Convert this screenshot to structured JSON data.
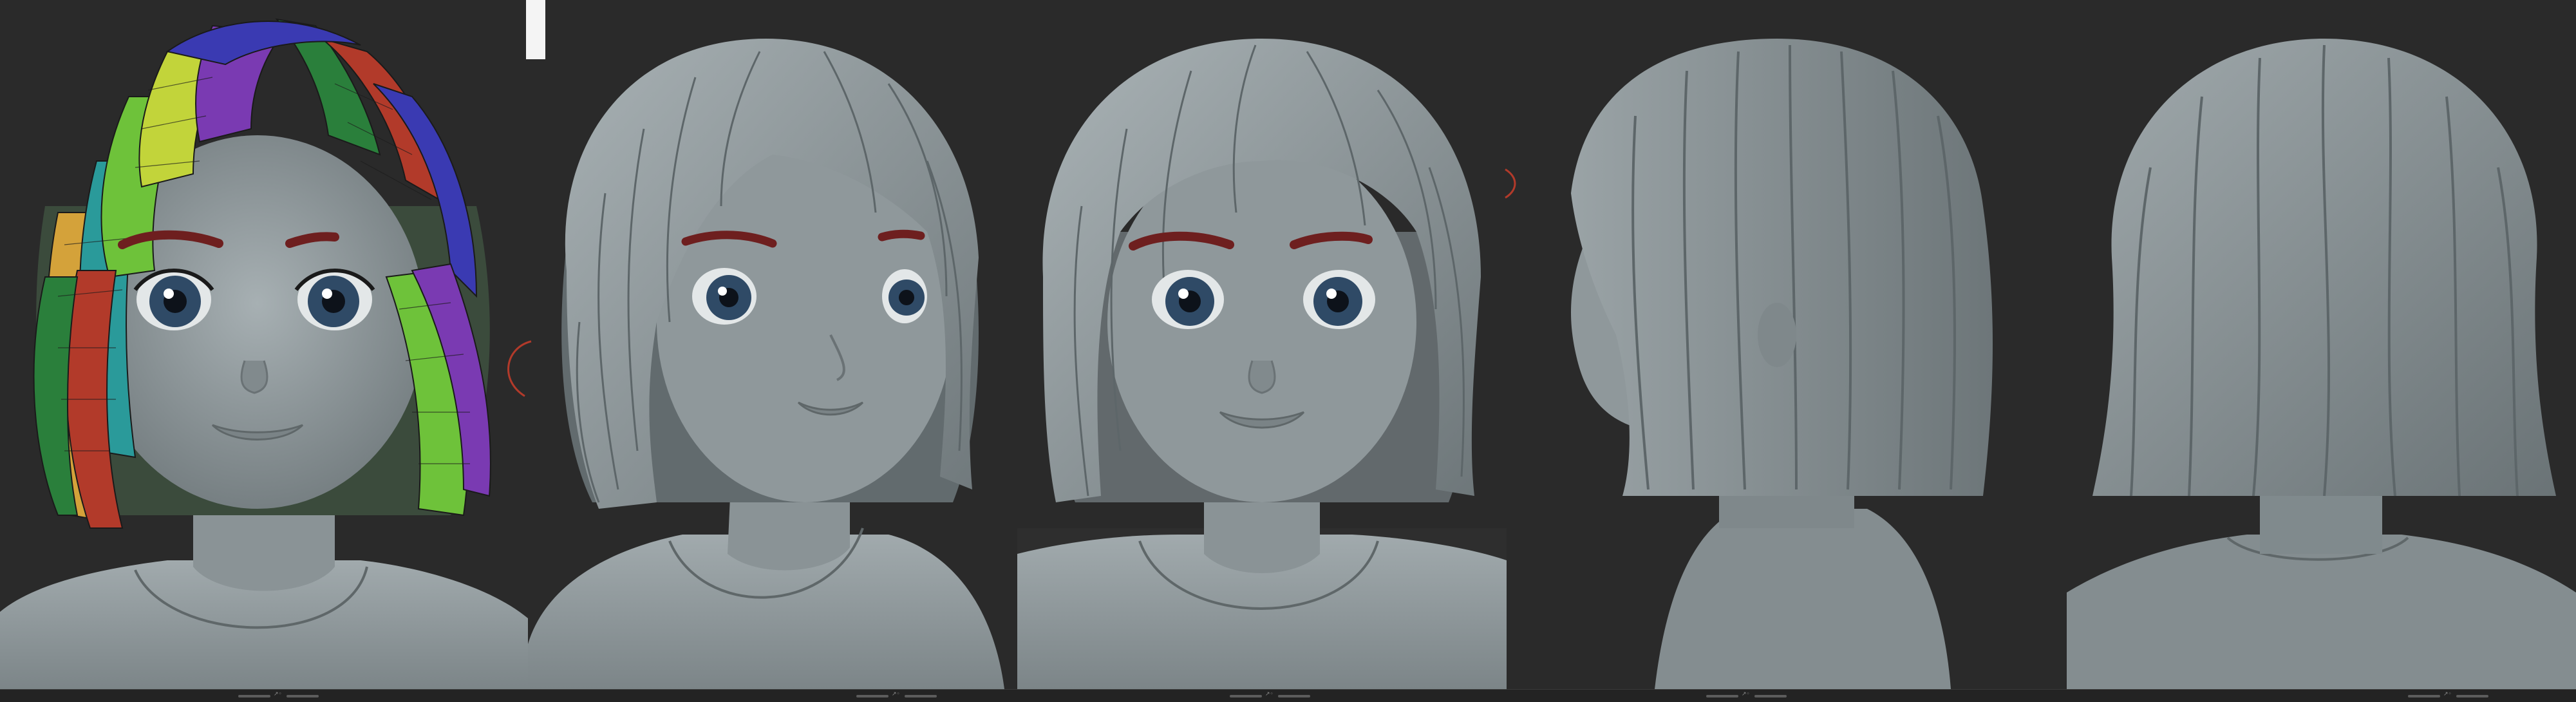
{
  "scene": {
    "background_color": "#2a2a2a",
    "skin_color": "#8e979a",
    "hair_color": "#8b9497",
    "brow_color": "#6e1f1f",
    "iris_color": "#2f4a66",
    "polygroup_colors": [
      "#2a7f3b",
      "#6ec23a",
      "#c2d43a",
      "#b23a2a",
      "#3a3ab2",
      "#7a3ab2",
      "#d4a23a",
      "#2a9a9a"
    ]
  },
  "views": [
    {
      "name": "front-polygroups"
    },
    {
      "name": "three-quarter-left"
    },
    {
      "name": "front"
    },
    {
      "name": "side-profile"
    },
    {
      "name": "back"
    }
  ],
  "bottom_bar": {
    "glyph": "↗◦"
  }
}
